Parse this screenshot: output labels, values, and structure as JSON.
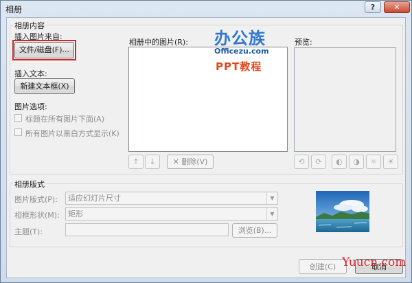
{
  "window": {
    "title": "相册",
    "help_label": "?",
    "close_label": "✕"
  },
  "album_content": {
    "group_label": "相册内容",
    "insert_from_label": "插入图片来自:",
    "file_disk_button": "文件/磁盘(F)...",
    "insert_text_label": "插入文本:",
    "new_textbox_button": "新建文本框(X)",
    "picture_options_label": "图片选项:",
    "options": [
      {
        "label": "标题在所有图片下面(A)",
        "checked": false
      },
      {
        "label": "所有图片以黑白方式显示(K)",
        "checked": false
      }
    ],
    "pictures_in_album_label": "相册中的图片(R):",
    "remove_button": "删除(V)",
    "preview_label": "预览:"
  },
  "album_layout": {
    "group_label": "相册版式",
    "picture_layout_label": "图片版式(P):",
    "picture_layout_value": "适应幻灯片尺寸",
    "frame_shape_label": "相框形状(M):",
    "frame_shape_value": "矩形",
    "theme_label": "主题(T):",
    "theme_value": "",
    "browse_button": "浏览(B)..."
  },
  "footer": {
    "create_button": "创建(C)",
    "cancel_button": "取消"
  },
  "watermarks": {
    "logo_main": "办公族",
    "logo_url": "Officezu.com",
    "logo_ppt": "PPT教程",
    "site": "Yuucn.com"
  },
  "icons": {
    "move_up": "arrow-up-icon",
    "move_down": "arrow-down-icon",
    "remove": "remove-x-icon",
    "rotate_left": "rotate-left-icon",
    "rotate_right": "rotate-right-icon",
    "contrast_up": "contrast-up-icon",
    "contrast_down": "contrast-down-icon",
    "brightness_up": "brightness-up-icon",
    "brightness_down": "brightness-down-icon"
  },
  "colors": {
    "highlight": "#d3252a",
    "titlebar": "#dce7f2",
    "dialog_bg": "#f0f0f0"
  }
}
